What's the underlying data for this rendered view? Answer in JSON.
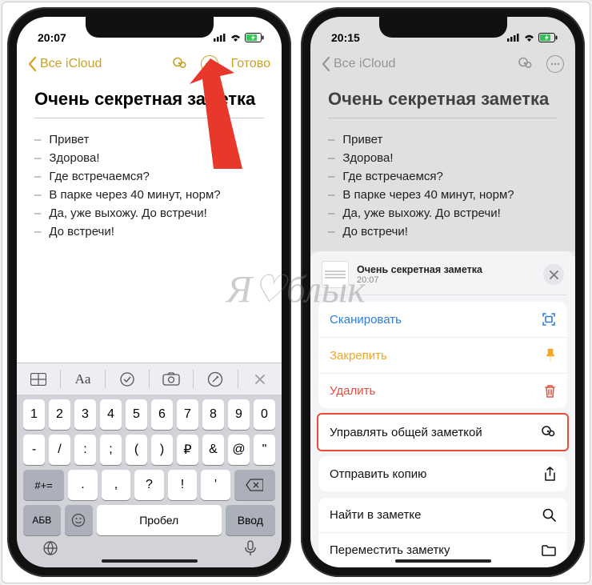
{
  "left": {
    "status": {
      "time": "20:07"
    },
    "nav": {
      "back": "Все iCloud",
      "done": "Готово"
    },
    "note": {
      "title": "Очень секретная заметка",
      "lines": [
        "Привет",
        "Здорова!",
        "Где встречаемся?",
        "В парке через 40 минут, норм?",
        "Да, уже выхожу. До встречи!",
        "До встречи!"
      ]
    },
    "kb_toolbar": {
      "format": "Aa"
    },
    "keyboard": {
      "row_num": [
        "1",
        "2",
        "3",
        "4",
        "5",
        "6",
        "7",
        "8",
        "9",
        "0"
      ],
      "row_sym": [
        "-",
        "/",
        ":",
        ";",
        "(",
        ")",
        "₽",
        "&",
        "@",
        "\""
      ],
      "row_punct_switch": "#+=",
      "row_punct": [
        ".",
        ",",
        "?",
        "!",
        "'"
      ],
      "abc": "АБВ",
      "space": "Пробел",
      "enter": "Ввод"
    }
  },
  "right": {
    "status": {
      "time": "20:15"
    },
    "nav": {
      "back": "Все iCloud"
    },
    "note": {
      "title": "Очень секретная заметка",
      "lines": [
        "Привет",
        "Здорова!",
        "Где встречаемся?",
        "В парке через 40 минут, норм?",
        "Да, уже выхожу. До встречи!",
        "До встречи!"
      ]
    },
    "sheet": {
      "title": "Очень секретная заметка",
      "time": "20:07",
      "actions": {
        "scan": "Сканировать",
        "pin": "Закрепить",
        "delete": "Удалить",
        "manage": "Управлять общей заметкой",
        "send_copy": "Отправить копию",
        "find": "Найти в заметке",
        "move": "Переместить заметку"
      }
    }
  },
  "watermark": "Я♡блык"
}
